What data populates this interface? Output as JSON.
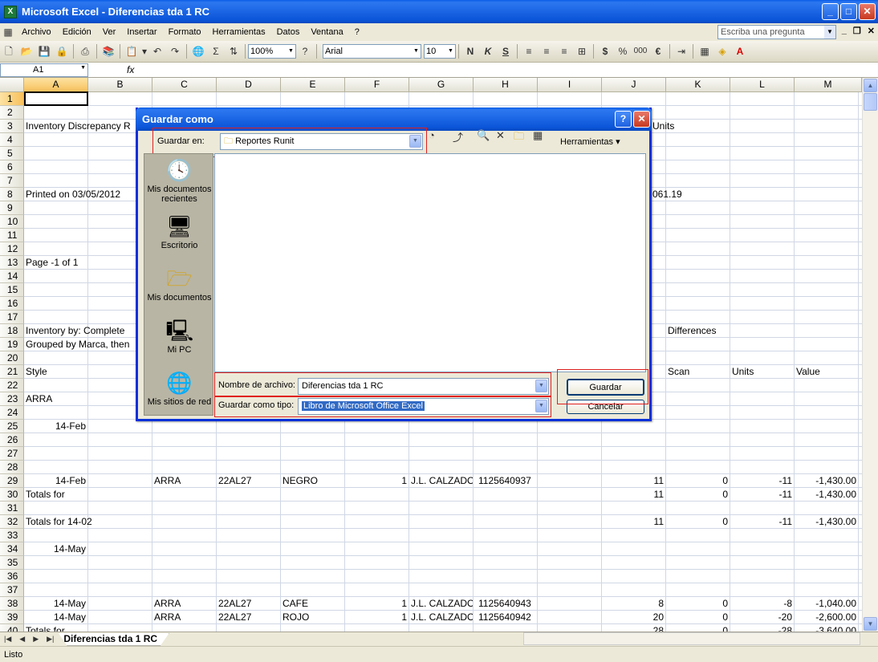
{
  "app": {
    "title": "Microsoft Excel - Diferencias tda 1 RC"
  },
  "menu": {
    "items": [
      "Archivo",
      "Edición",
      "Ver",
      "Insertar",
      "Formato",
      "Herramientas",
      "Datos",
      "Ventana",
      "?"
    ],
    "ask_placeholder": "Escriba una pregunta"
  },
  "toolbar": {
    "zoom": "100%",
    "font": "Arial",
    "font_size": "10",
    "bold": "N",
    "italic": "K",
    "underline": "S",
    "currency": "$",
    "percent": "%",
    "thousands": "000",
    "euro": "€"
  },
  "formula_bar": {
    "name_box": "A1",
    "fx": "fx"
  },
  "columns": [
    "A",
    "B",
    "C",
    "D",
    "E",
    "F",
    "G",
    "H",
    "I",
    "J",
    "K",
    "L",
    "M"
  ],
  "rows": [
    "1",
    "2",
    "3",
    "4",
    "5",
    "6",
    "7",
    "8",
    "9",
    "10",
    "11",
    "12",
    "13",
    "14",
    "15",
    "16",
    "17",
    "18",
    "19",
    "20",
    "21",
    "22",
    "23",
    "24",
    "25",
    "26",
    "27",
    "28",
    "29",
    "30",
    "31",
    "32",
    "33",
    "34",
    "35",
    "36",
    "37",
    "38",
    "39",
    "40"
  ],
  "cells": {
    "r3a": "Inventory Discrepancy R",
    "r3k": "Units",
    "r8a": "Printed on 03/05/2012",
    "r8k": "061.19",
    "r13a": "Page -1 of 1",
    "r18a": "Inventory by:  Complete",
    "r18k": "Differences",
    "r19a": "Grouped by Marca, then",
    "r21a": "Style",
    "r21k": "Scan",
    "r21l": "Units",
    "r21m": "Value",
    "r23a": "ARRA",
    "r25a": "14-Feb",
    "r29a": "14-Feb",
    "r29c": "ARRA",
    "r29d": "22AL27",
    "r29e": "NEGRO",
    "r29f": "1",
    "r29g": "J.L. CALZADO",
    "r29h": "1125640937",
    "r29j": "11",
    "r29k": "0",
    "r29l": "-11",
    "r29m": "-1,430.00",
    "r30a": "Totals for",
    "r30j": "11",
    "r30k": "0",
    "r30l": "-11",
    "r30m": "-1,430.00",
    "r32a": "Totals for 14-02",
    "r32j": "11",
    "r32k": "0",
    "r32l": "-11",
    "r32m": "-1,430.00",
    "r34a": "14-May",
    "r38a": "14-May",
    "r38c": "ARRA",
    "r38d": "22AL27",
    "r38e": "CAFE",
    "r38f": "1",
    "r38g": "J.L. CALZADO",
    "r38h": "1125640943",
    "r38j": "8",
    "r38k": "0",
    "r38l": "-8",
    "r38m": "-1,040.00",
    "r39a": "14-May",
    "r39c": "ARRA",
    "r39d": "22AL27",
    "r39e": "ROJO",
    "r39f": "1",
    "r39g": "J.L. CALZADO",
    "r39h": "1125640942",
    "r39j": "20",
    "r39k": "0",
    "r39l": "-20",
    "r39m": "-2,600.00",
    "r40a": "Totals for",
    "r40j": "28",
    "r40k": "0",
    "r40l": "-28",
    "r40m": "-3,640.00"
  },
  "sheet_tab": "Diferencias tda 1 RC",
  "status": "Listo",
  "dialog": {
    "title": "Guardar como",
    "save_in_label": "Guardar en:",
    "save_in_value": "Reportes Runit",
    "tools_label": "Herramientas",
    "places": [
      "Mis documentos recientes",
      "Escritorio",
      "Mis documentos",
      "Mi PC",
      "Mis sitios de red"
    ],
    "filename_label": "Nombre de archivo:",
    "filename_value": "Diferencias tda 1 RC",
    "filetype_label": "Guardar como tipo:",
    "filetype_value": "Libro de Microsoft Office Excel",
    "save_button": "Guardar",
    "cancel_button": "Cancelar"
  },
  "colors": {
    "titlebar": "#0b55d9",
    "highlight_box": "#e02020",
    "selection": "#316ac5"
  }
}
